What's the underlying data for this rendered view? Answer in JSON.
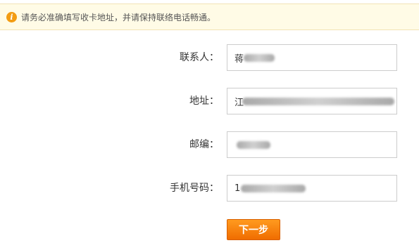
{
  "notice": {
    "icon": "info-icon",
    "icon_glyph": "i",
    "text": "请务必准确填写收卡地址，并请保持联络电话畅通。"
  },
  "form": {
    "contact": {
      "label": "联系人：",
      "value": "蒋"
    },
    "address": {
      "label": "地址：",
      "value": "江"
    },
    "postcode": {
      "label": "邮编：",
      "value": ""
    },
    "phone": {
      "label": "手机号码：",
      "value": "1"
    }
  },
  "next_button": {
    "label": "下一步"
  },
  "colors": {
    "accent": "#f57f0f",
    "notice_bg": "#fffbe6"
  }
}
